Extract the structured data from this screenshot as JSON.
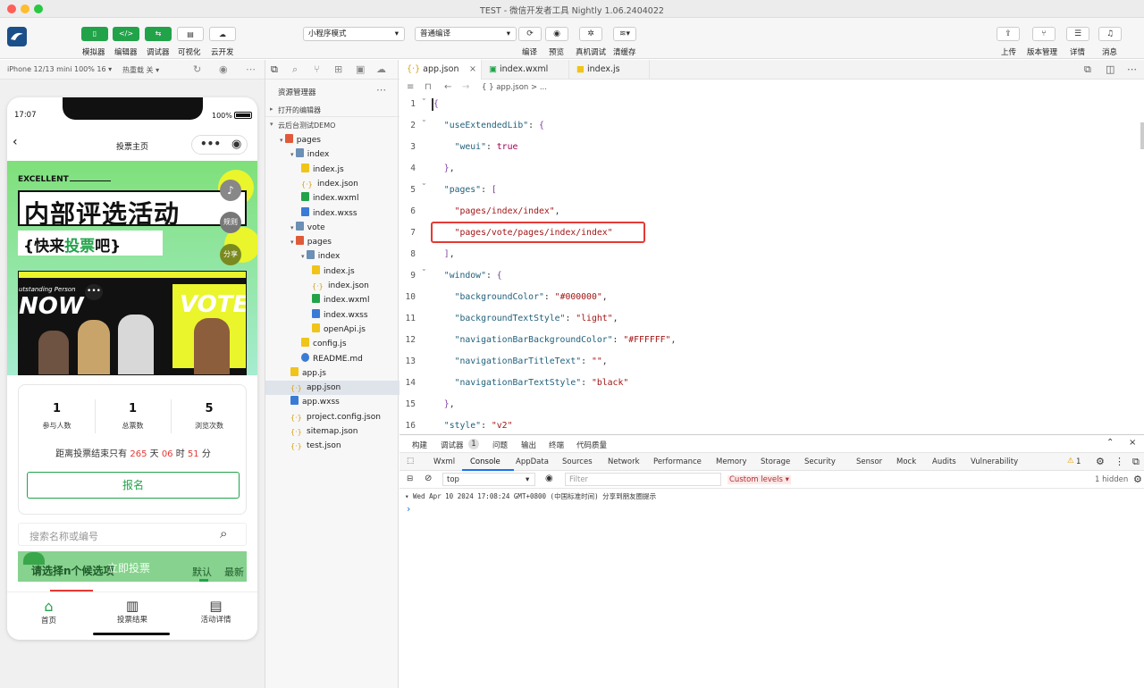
{
  "window": {
    "title": "TEST - 微信开发者工具 Nightly 1.06.2404022"
  },
  "toolbar": {
    "buttons": [
      "模拟器",
      "编辑器",
      "调试器",
      "可视化",
      "云开发"
    ],
    "mode_select": "小程序模式",
    "compile_select": "普通编译",
    "actions": [
      "编译",
      "预览",
      "真机调试",
      "清缓存"
    ],
    "right_actions": [
      "上传",
      "版本管理",
      "详情",
      "消息"
    ]
  },
  "simbar": {
    "device": "iPhone 12/13 mini 100% 16 ▾",
    "hot_reload": "热重载 关 ▾"
  },
  "phone": {
    "status_time": "17:07",
    "battery": "100%",
    "nav_title": "投票主页",
    "banner": {
      "excellent": "EXCELLENT",
      "headline": "内部评选活动",
      "sub_pre": "{快来",
      "sub_hi": "投票",
      "sub_post": "吧}",
      "rules": "规则",
      "share": "分享",
      "outstanding": "utstanding Person",
      "now": "NOW",
      "vote": "VOTE"
    },
    "stats": [
      {
        "value": "1",
        "label": "参与人数"
      },
      {
        "value": "1",
        "label": "总票数"
      },
      {
        "value": "5",
        "label": "浏览次数"
      }
    ],
    "countdown": {
      "pre": "距离投票结束只有",
      "d": "265",
      "d_u": "天",
      "h": "06",
      "h_u": "时",
      "m": "51",
      "m_u": "分"
    },
    "signup": "报名",
    "search_placeholder": "搜索名称或编号",
    "vote_bar": {
      "hint": "请选择n个候选项",
      "button": "立即投票",
      "tab_default": "默认",
      "tab_latest": "最新"
    },
    "tabbar": [
      "首页",
      "投票结果",
      "活动详情"
    ]
  },
  "explorer": {
    "title": "资源管理器",
    "open_editors": "打开的编辑器",
    "project": "云后台测试DEMO",
    "items": [
      {
        "name": "pages",
        "type": "folder-red"
      },
      {
        "name": "index",
        "type": "folder"
      },
      {
        "name": "index.js",
        "type": "js"
      },
      {
        "name": "index.json",
        "type": "json"
      },
      {
        "name": "index.wxml",
        "type": "wxml"
      },
      {
        "name": "index.wxss",
        "type": "wxss"
      },
      {
        "name": "vote",
        "type": "folder"
      },
      {
        "name": "pages",
        "type": "folder-red"
      },
      {
        "name": "index",
        "type": "folder"
      },
      {
        "name": "index.js",
        "type": "js"
      },
      {
        "name": "index.json",
        "type": "json"
      },
      {
        "name": "index.wxml",
        "type": "wxml"
      },
      {
        "name": "index.wxss",
        "type": "wxss"
      },
      {
        "name": "openApi.js",
        "type": "js"
      },
      {
        "name": "config.js",
        "type": "js"
      },
      {
        "name": "README.md",
        "type": "md"
      },
      {
        "name": "app.js",
        "type": "js"
      },
      {
        "name": "app.json",
        "type": "json"
      },
      {
        "name": "app.wxss",
        "type": "wxss"
      },
      {
        "name": "project.config.json",
        "type": "json"
      },
      {
        "name": "sitemap.json",
        "type": "json"
      },
      {
        "name": "test.json",
        "type": "json"
      }
    ]
  },
  "editor": {
    "tabs": [
      "app.json",
      "index.wxml",
      "index.js"
    ],
    "breadcrumb": "{ } app.json > ...",
    "line_numbers": [
      "1",
      "2",
      "3",
      "4",
      "5",
      "6",
      "7",
      "8",
      "9",
      "10",
      "11",
      "12",
      "13",
      "14",
      "15",
      "16"
    ]
  },
  "devtools": {
    "top_tabs": [
      "构建",
      "调试器",
      "1",
      "问题",
      "输出",
      "终端",
      "代码质量"
    ],
    "panels": [
      "Wxml",
      "Console",
      "AppData",
      "Sources",
      "Network",
      "Performance",
      "Memory",
      "Storage",
      "Security",
      "Sensor",
      "Mock",
      "Audits",
      "Vulnerability"
    ],
    "warn_count": "1",
    "context": "top",
    "filter_placeholder": "Filter",
    "levels": "Custom levels ▾",
    "hidden": "1 hidden",
    "log": "▾ Wed Apr 10 2024 17:08:24 GMT+0800 (中国标准时间) 分享到朋友圈提示",
    "prompt": "›"
  }
}
